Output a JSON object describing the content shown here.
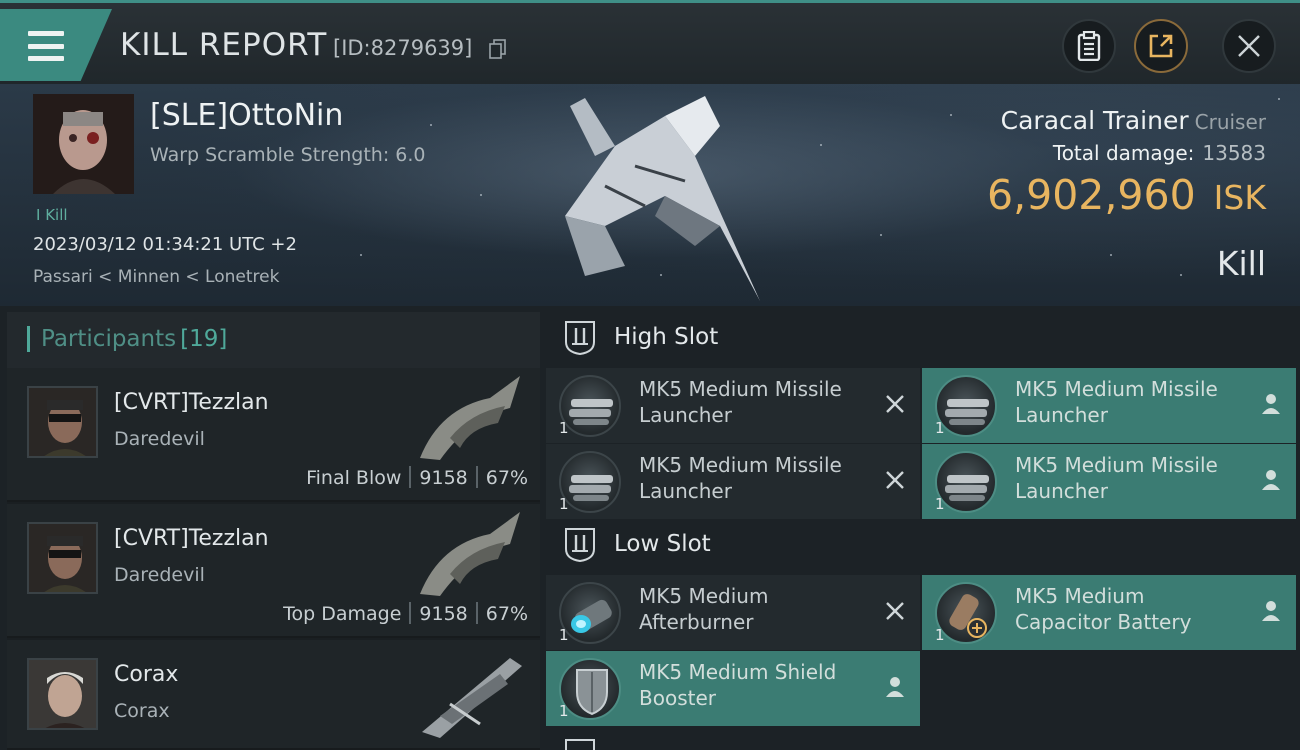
{
  "header": {
    "title": "KILL REPORT",
    "report_id": "[ID:8279639]"
  },
  "victim": {
    "name": "[SLE]OttoNin",
    "warp_scramble": "Warp Scramble Strength: 6.0",
    "kill_tag": "I Kill",
    "timestamp": "2023/03/12 01:34:21 UTC +2",
    "location": "Passari < Minnen < Lonetrek",
    "ship_name": "Caracal Trainer",
    "ship_class": "Cruiser",
    "total_damage_label": "Total damage:",
    "total_damage": "13583",
    "isk_value": "6,902,960",
    "isk_unit": "ISK",
    "result": "Kill"
  },
  "participants": {
    "title": "Participants",
    "count": "[19]",
    "rows": [
      {
        "name": "[CVRT]Tezzlan",
        "ship": "Daredevil",
        "role": "Final Blow",
        "damage": "9158",
        "percent": "67%"
      },
      {
        "name": "[CVRT]Tezzlan",
        "ship": "Daredevil",
        "role": "Top Damage",
        "damage": "9158",
        "percent": "67%"
      },
      {
        "name": "Corax",
        "ship": "Corax",
        "role": "",
        "damage": "",
        "percent": ""
      }
    ]
  },
  "fitting": {
    "high_slot": {
      "title": "High Slot",
      "modules": [
        {
          "name": "MK5 Medium Missile Launcher",
          "qty": "1",
          "status": "destroyed"
        },
        {
          "name": "MK5 Medium Missile Launcher",
          "qty": "1",
          "status": "dropped"
        },
        {
          "name": "MK5 Medium Missile Launcher",
          "qty": "1",
          "status": "destroyed"
        },
        {
          "name": "MK5 Medium Missile Launcher",
          "qty": "1",
          "status": "dropped"
        }
      ]
    },
    "low_slot": {
      "title": "Low Slot",
      "modules": [
        {
          "name": "MK5 Medium Afterburner",
          "qty": "1",
          "status": "destroyed"
        },
        {
          "name": "MK5 Medium Capacitor Battery",
          "qty": "1",
          "status": "dropped"
        },
        {
          "name": "MK5 Medium Shield Booster",
          "qty": "1",
          "status": "dropped"
        }
      ]
    }
  },
  "colors": {
    "accent_teal": "#3b8a80",
    "isk_gold": "#e8b560",
    "dropped_bg": "#3b7c73",
    "destroyed_bg": "#232a2e"
  },
  "icons": [
    "menu-icon",
    "copy-icon",
    "clipboard-icon",
    "share-icon",
    "close-icon",
    "slot-icon",
    "destroyed-x-icon",
    "person-icon"
  ]
}
